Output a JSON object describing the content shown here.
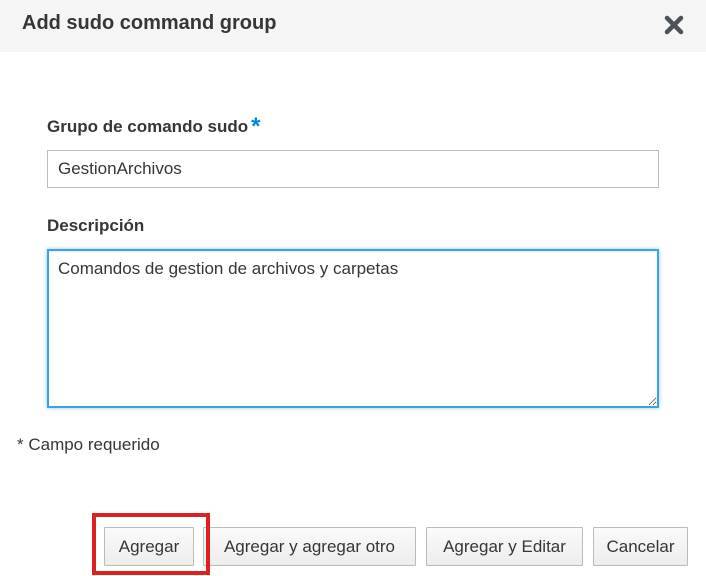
{
  "dialog": {
    "title": "Add sudo command group",
    "close_icon": "close-icon"
  },
  "form": {
    "group_label": "Grupo de comando sudo",
    "required_marker": "*",
    "group_value": "GestionArchivos",
    "description_label": "Descripción",
    "description_value": "Comandos de gestion de archivos y carpetas",
    "required_note": "* Campo requerido"
  },
  "buttons": {
    "add": "Agregar",
    "add_another": "Agregar y agregar otro",
    "add_edit": "Agregar y Editar",
    "cancel": "Cancelar"
  },
  "colors": {
    "header_bg": "#f5f5f5",
    "required_star": "#0088ce",
    "focus_border": "#39a5dc",
    "highlight": "#e02020"
  }
}
